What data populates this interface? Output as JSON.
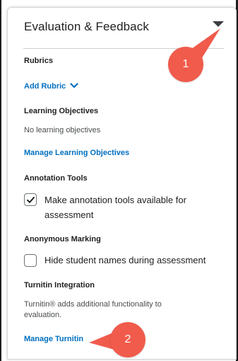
{
  "header": {
    "title": "Evaluation & Feedback",
    "collapse_icon": "caret-down-icon"
  },
  "rubrics": {
    "label": "Rubrics",
    "add_link": "Add Rubric",
    "add_icon": "chevron-down-icon"
  },
  "learning_objectives": {
    "label": "Learning Objectives",
    "empty_text": "No learning objectives",
    "manage_link": "Manage Learning Objectives"
  },
  "annotation_tools": {
    "label": "Annotation Tools",
    "checkbox_text_line1": "Make annotation tools available for",
    "checkbox_text_line2": "assessment",
    "checked": true
  },
  "anonymous_marking": {
    "label": "Anonymous Marking",
    "checkbox_text": "Hide student names during assessment",
    "checked": false
  },
  "turnitin": {
    "label": "Turnitin Integration",
    "description_line1": "Turnitin® adds additional functionality to",
    "description_line2": "evaluation.",
    "manage_link": "Manage Turnitin"
  },
  "callouts": [
    {
      "number": "1"
    },
    {
      "number": "2"
    }
  ],
  "colors": {
    "link": "#006fbf",
    "callout": "#f05b4c",
    "text": "#202122"
  }
}
